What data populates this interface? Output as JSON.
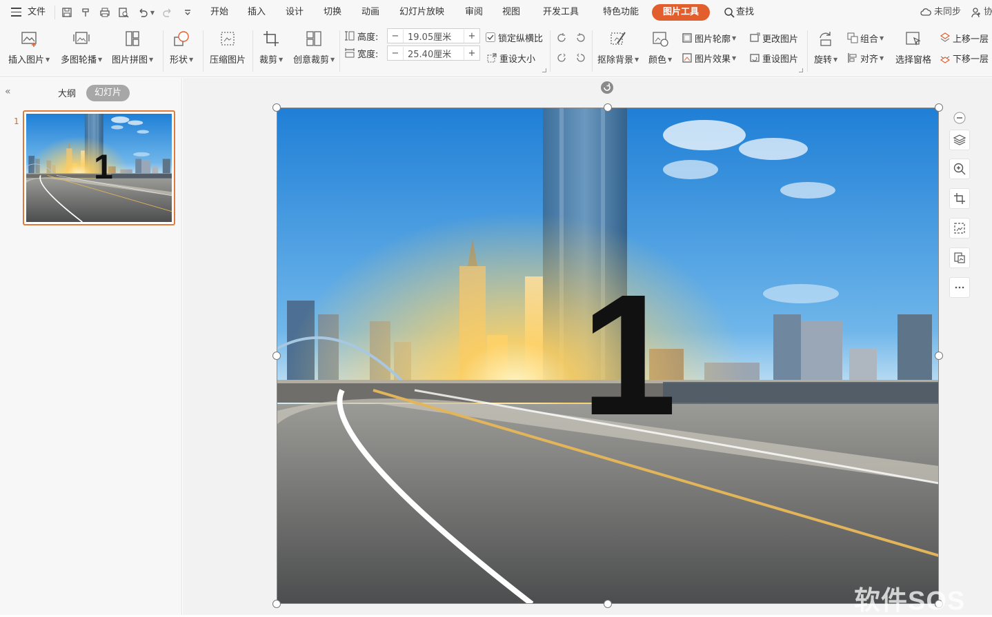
{
  "menu": {
    "file": "文件",
    "tabs": [
      "开始",
      "插入",
      "设计",
      "切换",
      "动画",
      "幻灯片放映",
      "审阅",
      "视图",
      "开发工具",
      "特色功能"
    ],
    "active_tab": "图片工具",
    "search": "查找",
    "sync": "未同步",
    "collab": "协"
  },
  "ribbon": {
    "insert_picture": "插入图片",
    "multi_carousel": "多图轮播",
    "collage": "图片拼图",
    "shape": "形状",
    "compress": "压缩图片",
    "crop": "裁剪",
    "creative_crop": "创意裁剪",
    "height_label": "高度:",
    "height_value": "19.05厘米",
    "width_label": "宽度:",
    "width_value": "25.40厘米",
    "lock_ratio": "锁定纵横比",
    "reset_size": "重设大小",
    "remove_bg": "抠除背景",
    "color": "颜色",
    "outline": "图片轮廓",
    "effects": "图片效果",
    "change_picture": "更改图片",
    "reset_picture": "重设图片",
    "rotate": "旋转",
    "group": "组合",
    "align": "对齐",
    "selection_pane": "选择窗格",
    "bring_forward": "上移一层",
    "send_backward": "下移一层",
    "minus": "−",
    "plus": "+"
  },
  "panel": {
    "outline_tab": "大纲",
    "slides_tab": "幻灯片",
    "slide_number": "1",
    "collapse": "«"
  },
  "slide": {
    "big_text": "1"
  },
  "watermark": "软件SOS",
  "colors": {
    "accent": "#e25f2d",
    "thumb_border": "#e07a3c"
  }
}
